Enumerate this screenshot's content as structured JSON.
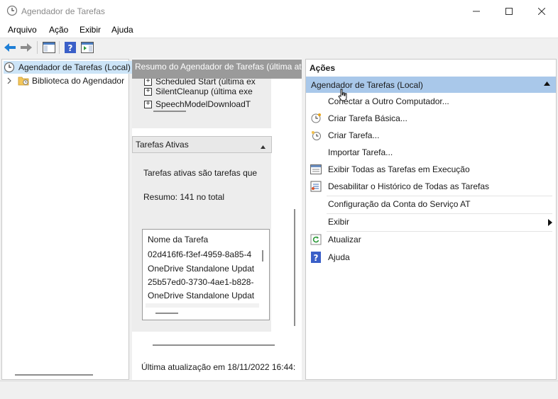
{
  "window": {
    "title": "Agendador de Tarefas"
  },
  "menu": [
    "Arquivo",
    "Ação",
    "Exibir",
    "Ajuda"
  ],
  "tree": {
    "root": "Agendador de Tarefas (Local)",
    "library": "Biblioteca do Agendador"
  },
  "middle": {
    "header": "Resumo do Agendador de Tarefas (última atu",
    "tasks_top": [
      "Scheduled Start (última ex",
      "SilentCleanup (última exe",
      "SpeechModelDownloadT"
    ],
    "active_section_title": "Tarefas Ativas",
    "active_description": "Tarefas ativas são tarefas que",
    "active_summary": "Resumo: 141 no total",
    "task_list_header": "Nome da Tarefa",
    "task_list_rows": [
      "02d416f6-f3ef-4959-8a85-4",
      "OneDrive Standalone Updat",
      "25b57ed0-3730-4ae1-b828-",
      "OneDrive Standalone Updat"
    ],
    "last_update": "Última atualização em 18/11/2022 16:44:"
  },
  "actions": {
    "title": "Ações",
    "section": "Agendador de Tarefas (Local)",
    "items": [
      {
        "label": "Conectar a Outro Computador...",
        "icon": "none"
      },
      {
        "label": "Criar Tarefa Básica...",
        "icon": "wizard-icon"
      },
      {
        "label": "Criar Tarefa...",
        "icon": "create-task-icon"
      },
      {
        "label": "Importar Tarefa...",
        "icon": "none"
      },
      {
        "label": "Exibir Todas as Tarefas em Execução",
        "icon": "running-tasks-icon"
      },
      {
        "label": "Desabilitar o Histórico de Todas as Tarefas",
        "icon": "history-icon"
      },
      {
        "label": "Configuração da Conta do Serviço AT",
        "icon": "none"
      },
      {
        "label": "Exibir",
        "icon": "none"
      },
      {
        "label": "Atualizar",
        "icon": "refresh-icon"
      },
      {
        "label": "Ajuda",
        "icon": "help-icon"
      }
    ]
  },
  "colors": {
    "selection": "#cce4f7",
    "section_header": "#a9c8ea",
    "mid_header": "#9a9a9a"
  }
}
